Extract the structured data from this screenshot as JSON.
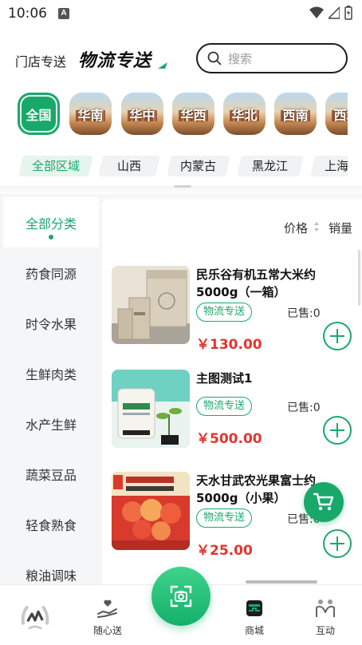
{
  "status_bar": {
    "time": "10:06",
    "notification_icon": "A"
  },
  "header": {
    "tab_store": "门店专送",
    "tab_logistics": "物流专送",
    "search_placeholder": "搜索"
  },
  "regions": [
    {
      "label": "全国",
      "active": true
    },
    {
      "label": "华南",
      "active": false
    },
    {
      "label": "华中",
      "active": false
    },
    {
      "label": "华西",
      "active": false
    },
    {
      "label": "华北",
      "active": false
    },
    {
      "label": "西南",
      "active": false
    },
    {
      "label": "西北",
      "active": false
    }
  ],
  "provinces": [
    {
      "label": "全部区域",
      "active": true
    },
    {
      "label": "山西",
      "active": false
    },
    {
      "label": "内蒙古",
      "active": false
    },
    {
      "label": "黑龙江",
      "active": false
    },
    {
      "label": "上海",
      "active": false
    }
  ],
  "categories": [
    {
      "label": "全部分类",
      "active": true
    },
    {
      "label": "药食同源",
      "active": false
    },
    {
      "label": "时令水果",
      "active": false
    },
    {
      "label": "生鲜肉类",
      "active": false
    },
    {
      "label": "水产生鲜",
      "active": false
    },
    {
      "label": "蔬菜豆品",
      "active": false
    },
    {
      "label": "轻食熟食",
      "active": false
    },
    {
      "label": "粮油调味",
      "active": false
    }
  ],
  "sort": {
    "price": "价格",
    "sales": "销量"
  },
  "products": [
    {
      "name": "民乐谷有机五常大米约5000g（一箱）",
      "tag": "物流专送",
      "sold": "已售:0",
      "price": "￥130.00"
    },
    {
      "name": "主图测试1",
      "tag": "物流专送",
      "sold": "已售:0",
      "price": "￥500.00"
    },
    {
      "name": "天水甘武农光果富士约5000g（小果）",
      "tag": "物流专送",
      "sold": "已售:0",
      "price": "￥25.00"
    }
  ],
  "bottom_nav": [
    {
      "label": "",
      "icon": "wheat-logo-icon"
    },
    {
      "label": "随心送",
      "icon": "hand-heart-icon"
    },
    {
      "label": "",
      "icon": "scan-icon"
    },
    {
      "label": "商城",
      "icon": "store-icon"
    },
    {
      "label": "互动",
      "icon": "people-icon"
    }
  ],
  "colors": {
    "accent": "#1aa86a",
    "price": "#e5342e"
  }
}
